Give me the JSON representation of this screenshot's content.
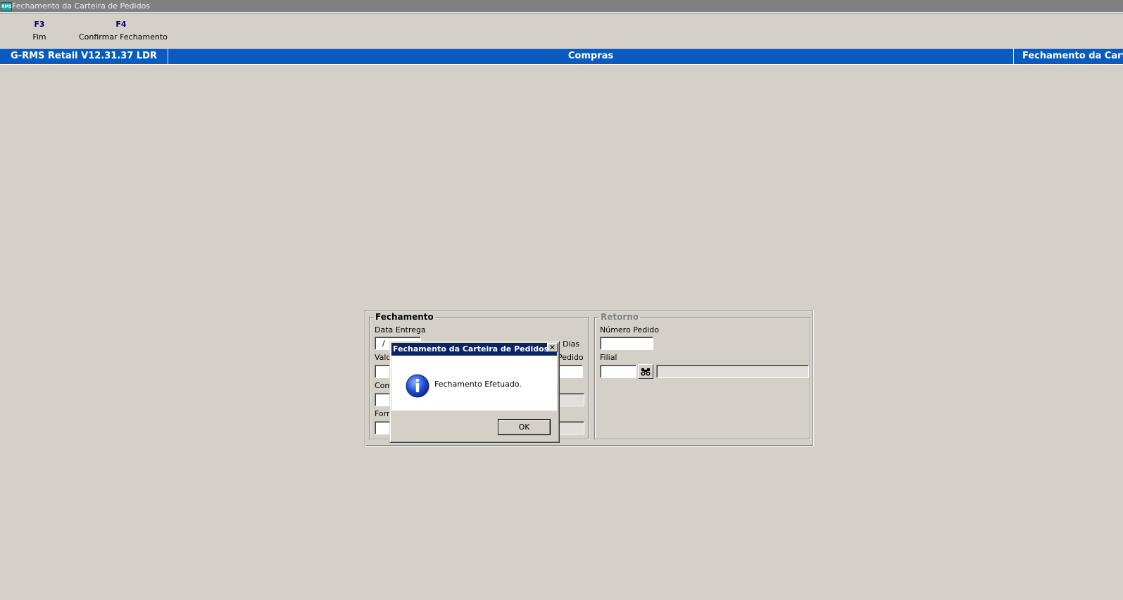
{
  "window": {
    "app_icon_text": "RMS",
    "title": "Fechamento da Carteira de Pedidos"
  },
  "function_keys": [
    {
      "key": "F3",
      "label": "Fim"
    },
    {
      "key": "F4",
      "label": "Confirmar Fechamento"
    }
  ],
  "header_bar": {
    "version": "G-RMS Retail V12.31.37 LDR",
    "module": "Compras",
    "screen": "Fechamento da Carteir"
  },
  "form": {
    "fechamento": {
      "legend": "Fechamento",
      "data_entrega_label": "Data Entrega",
      "data_entrega_value": "/",
      "dias_label": "(0) Dias",
      "valor_label": "Valo",
      "pedido_label": "Pedido",
      "comprador_label": "Com",
      "fornecedor_label": "Forn"
    },
    "retorno": {
      "legend": "Retorno",
      "numero_pedido_label": "Número Pedido",
      "filial_label": "Filial"
    }
  },
  "dialog": {
    "title": "Fechamento da Carteira de Pedidos",
    "message": "Fechamento Efetuado.",
    "ok_label": "OK",
    "close_glyph": "✕"
  },
  "colors": {
    "window_bg": "#d4d0c8",
    "header_blue": "#0a5bbf",
    "dialog_title_blue": "#0a246a",
    "fkey_color": "#000080"
  }
}
